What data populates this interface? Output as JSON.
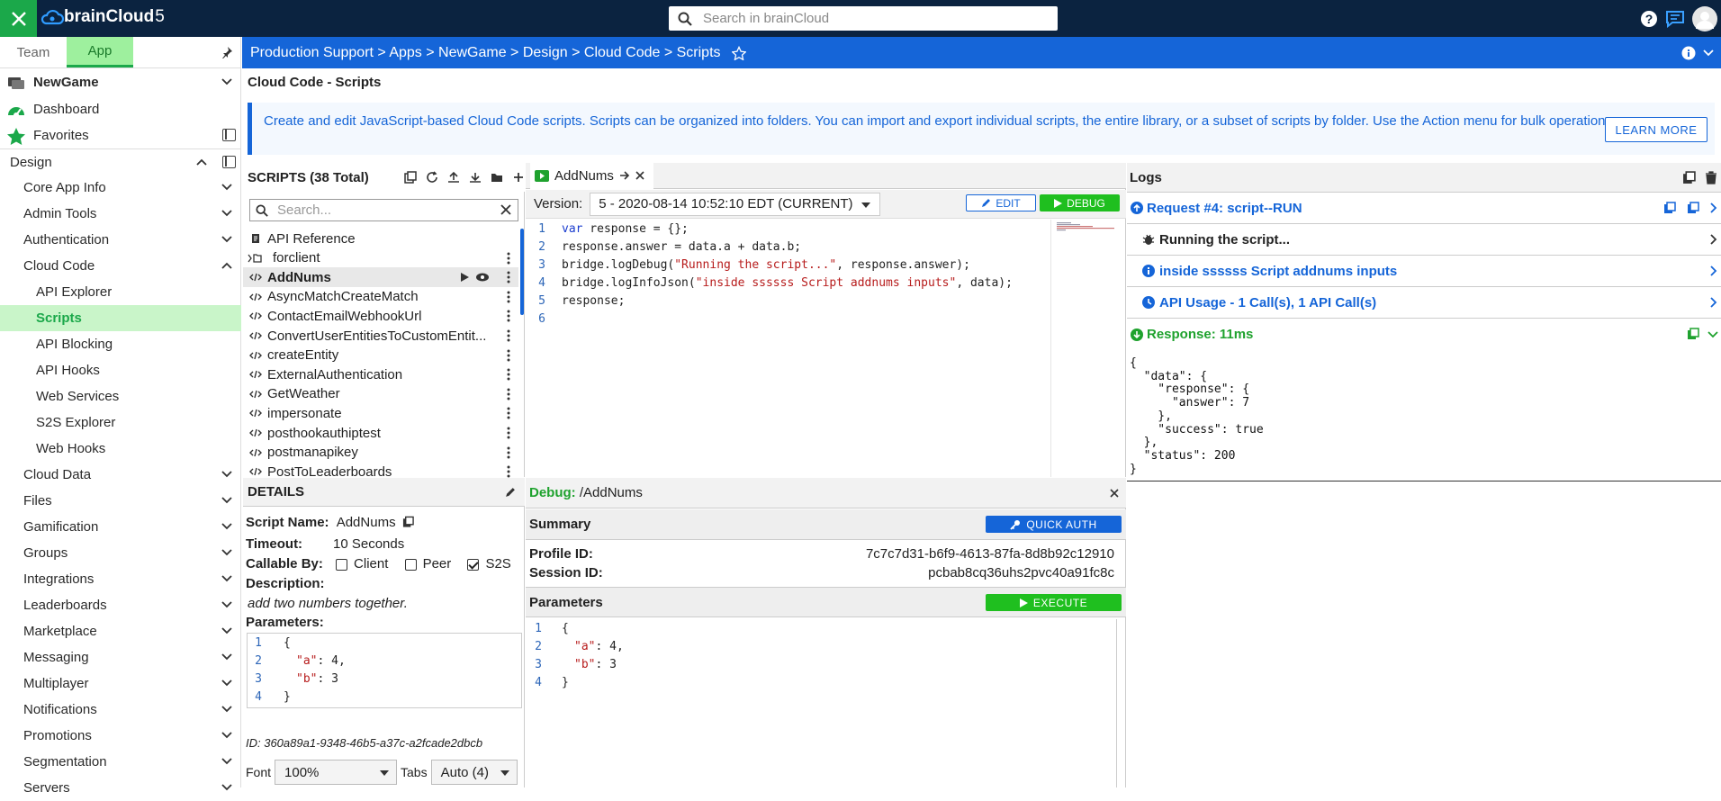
{
  "topbar": {
    "logo_text": "brainCloud",
    "logo_version": "5",
    "search_placeholder": "Search in brainCloud"
  },
  "left": {
    "tabs": [
      "Team",
      "App"
    ],
    "active_tab": "App",
    "app_name": "NewGame",
    "dashboard": "Dashboard",
    "favorites": "Favorites",
    "design": "Design",
    "items": [
      {
        "label": "Core App Info",
        "level": 1
      },
      {
        "label": "Admin Tools",
        "level": 1
      },
      {
        "label": "Authentication",
        "level": 1
      },
      {
        "label": "Cloud Code",
        "level": 1,
        "expanded": true
      },
      {
        "label": "API Explorer",
        "level": 2
      },
      {
        "label": "Scripts",
        "level": 2,
        "selected": true
      },
      {
        "label": "API Blocking",
        "level": 2
      },
      {
        "label": "API Hooks",
        "level": 2
      },
      {
        "label": "Web Services",
        "level": 2
      },
      {
        "label": "S2S Explorer",
        "level": 2
      },
      {
        "label": "Web Hooks",
        "level": 2
      },
      {
        "label": "Cloud Data",
        "level": 1
      },
      {
        "label": "Files",
        "level": 1
      },
      {
        "label": "Gamification",
        "level": 1
      },
      {
        "label": "Groups",
        "level": 1
      },
      {
        "label": "Integrations",
        "level": 1
      },
      {
        "label": "Leaderboards",
        "level": 1
      },
      {
        "label": "Marketplace",
        "level": 1
      },
      {
        "label": "Messaging",
        "level": 1
      },
      {
        "label": "Multiplayer",
        "level": 1
      },
      {
        "label": "Notifications",
        "level": 1
      },
      {
        "label": "Promotions",
        "level": 1
      },
      {
        "label": "Segmentation",
        "level": 1
      },
      {
        "label": "Servers",
        "level": 1
      }
    ]
  },
  "breadcrumb": "Production Support > Apps > NewGame > Design > Cloud Code > Scripts",
  "page_title": "Cloud Code - Scripts",
  "info": {
    "text": "Create and edit JavaScript-based Cloud Code scripts. Scripts can be organized into folders. You can import and export individual scripts, the entire library, or a subset of scripts by folder. Use the Action menu for bulk operations.",
    "learn_more": "LEARN MORE"
  },
  "scripts": {
    "title": "SCRIPTS (38 Total)",
    "search_placeholder": "Search...",
    "items": [
      {
        "name": "API Reference",
        "type": "doc"
      },
      {
        "name": "forclient",
        "type": "folder"
      },
      {
        "name": "AddNums",
        "type": "script",
        "selected": true
      },
      {
        "name": "AsyncMatchCreateMatch",
        "type": "script"
      },
      {
        "name": "ContactEmailWebhookUrl",
        "type": "script"
      },
      {
        "name": "ConvertUserEntitiesToCustomEntit...",
        "type": "script"
      },
      {
        "name": "createEntity",
        "type": "script"
      },
      {
        "name": "ExternalAuthentication",
        "type": "script"
      },
      {
        "name": "GetWeather",
        "type": "script"
      },
      {
        "name": "impersonate",
        "type": "script"
      },
      {
        "name": "posthookauthiptest",
        "type": "script"
      },
      {
        "name": "postmanapikey",
        "type": "script"
      },
      {
        "name": "PostToLeaderboards",
        "type": "script"
      }
    ]
  },
  "editor": {
    "tab": "AddNums",
    "version_label": "Version:",
    "version_value": "5 - 2020-08-14 10:52:10 EDT (CURRENT)",
    "edit": "EDIT",
    "debug": "DEBUG",
    "lines": [
      [
        {
          "t": "var",
          "c": "kw"
        },
        {
          "t": " response = {};",
          "c": ""
        }
      ],
      [
        {
          "t": "response.answer = data.a + data.b;",
          "c": ""
        }
      ],
      [
        {
          "t": "bridge.logDebug(",
          "c": ""
        },
        {
          "t": "\"Running the script...\"",
          "c": "str"
        },
        {
          "t": ", response.answer);",
          "c": ""
        }
      ],
      [
        {
          "t": "bridge.logInfoJson(",
          "c": ""
        },
        {
          "t": "\"inside ssssss Script addnums inputs\"",
          "c": "str"
        },
        {
          "t": ", data);",
          "c": ""
        }
      ],
      [
        {
          "t": "response;",
          "c": ""
        }
      ],
      []
    ]
  },
  "logs": {
    "title": "Logs",
    "request": "Request #4: script--RUN",
    "rows": [
      {
        "text": "Running the script...",
        "icon": "bug",
        "color": "dark"
      },
      {
        "text": "inside ssssss Script addnums inputs",
        "icon": "info",
        "color": "blue"
      },
      {
        "text": "API Usage - 1 Call(s), 1 API Call(s)",
        "icon": "clock",
        "color": "blue"
      }
    ],
    "response": "Response: 11ms",
    "json": "{\n  \"data\": {\n    \"response\": {\n      \"answer\": 7\n    },\n    \"success\": true\n  },\n  \"status\": 200\n}"
  },
  "details": {
    "title": "DETAILS",
    "script_name_label": "Script Name:",
    "script_name": "AddNums",
    "timeout_label": "Timeout:",
    "timeout": "10 Seconds",
    "callable_label": "Callable By:",
    "callable": [
      {
        "label": "Client",
        "checked": false
      },
      {
        "label": "Peer",
        "checked": false
      },
      {
        "label": "S2S",
        "checked": true
      }
    ],
    "description_label": "Description:",
    "description": "add two numbers together.",
    "parameters_label": "Parameters:",
    "params_lines": [
      [
        {
          "t": "{",
          "c": ""
        }
      ],
      [
        {
          "t": "\"a\"",
          "c": "str"
        },
        {
          "t": ": 4,",
          "c": ""
        }
      ],
      [
        {
          "t": "\"b\"",
          "c": "str"
        },
        {
          "t": ": 3",
          "c": ""
        }
      ],
      [
        {
          "t": "}",
          "c": ""
        }
      ]
    ],
    "id": "ID: 360a89a1-9348-46b5-a37c-a2fcade2dbcb",
    "font_label": "Font",
    "font_value": "100%",
    "tabs_label": "Tabs",
    "tabs_value": "Auto (4)"
  },
  "debug": {
    "title_prefix": "Debug:",
    "title_path": "/AddNums",
    "summary": "Summary",
    "quick_auth": "QUICK AUTH",
    "profile_label": "Profile ID:",
    "profile_id": "7c7c7d31-b6f9-4613-87fa-8d8b92c12910",
    "session_label": "Session ID:",
    "session_id": "pcbab8cq36uhs2pvc40a91fc8c",
    "parameters": "Parameters",
    "execute": "EXECUTE",
    "params_lines": [
      [
        {
          "t": "{",
          "c": ""
        }
      ],
      [
        {
          "t": "\"a\"",
          "c": "str"
        },
        {
          "t": ": 4,",
          "c": ""
        }
      ],
      [
        {
          "t": "\"b\"",
          "c": "str"
        },
        {
          "t": ": 3",
          "c": ""
        }
      ],
      [
        {
          "t": "}",
          "c": ""
        }
      ]
    ]
  },
  "colors": {
    "topbar": "#0b2340",
    "accent_green": "#1ba84a",
    "accent_blue": "#1565d8"
  }
}
